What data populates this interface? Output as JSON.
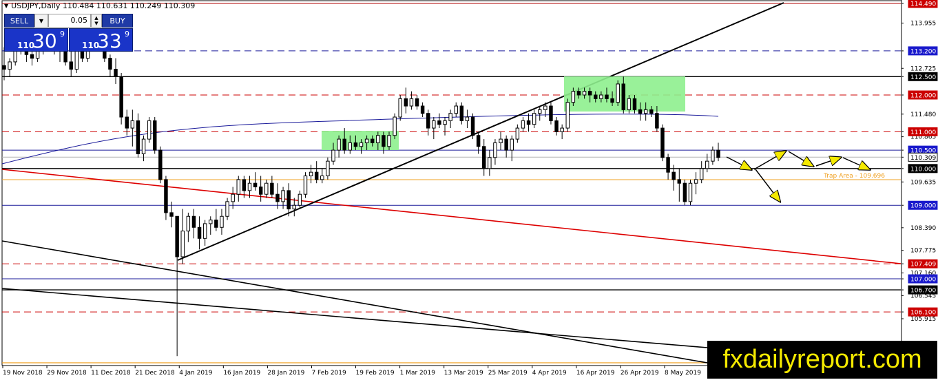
{
  "header": {
    "symbol_line": "USDJPY,Daily  110.484 110.631 110.249 110.309"
  },
  "trade_panel": {
    "sell_label": "SELL",
    "buy_label": "BUY",
    "lot_value": "0.05",
    "sell_price": {
      "prefix": "110",
      "big": "30",
      "sup": "9"
    },
    "buy_price": {
      "prefix": "110",
      "big": "33",
      "sup": "9"
    }
  },
  "watermark": "fxdailyreport.com",
  "chart_data": {
    "type": "candlestick",
    "title": "USDJPY,Daily",
    "ylim": [
      105.35,
      114.6
    ],
    "y_ticks": [
      "114.490",
      "113.955",
      "113.200",
      "112.725",
      "112.500",
      "112.000",
      "111.480",
      "111.000",
      "110.865",
      "110.500",
      "110.309",
      "110.000",
      "109.635",
      "109.000",
      "108.390",
      "107.775",
      "107.409",
      "107.160",
      "107.000",
      "106.700",
      "106.545",
      "106.100",
      "105.915"
    ],
    "x_labels": [
      "19 Nov 2018",
      "29 Nov 2018",
      "11 Dec 2018",
      "21 Dec 2018",
      "4 Jan 2019",
      "16 Jan 2019",
      "28 Jan 2019",
      "7 Feb 2019",
      "19 Feb 2019",
      "1 Mar 2019",
      "13 Mar 2019",
      "25 Mar 2019",
      "4 Apr 2019",
      "16 Apr 2019",
      "26 Apr 2019",
      "8 May 2019"
    ],
    "levels": [
      {
        "price": 114.49,
        "label": "114.490",
        "color": "#b00000",
        "style": "solid",
        "badge": "#cc0000"
      },
      {
        "price": 113.2,
        "label": "113.200",
        "color": "#1a1a9a",
        "style": "dashed",
        "badge": "#1a1acc"
      },
      {
        "price": 112.5,
        "label": "112.500",
        "color": "#000000",
        "style": "solid",
        "badge": "#000000"
      },
      {
        "price": 112.0,
        "label": "112.000",
        "color": "#cc0000",
        "style": "dashed",
        "badge": "#cc0000"
      },
      {
        "price": 111.0,
        "label": "111.000",
        "color": "#cc0000",
        "style": "dashed",
        "badge": "#cc0000"
      },
      {
        "price": 110.5,
        "label": "110.500",
        "color": "#1a1a9a",
        "style": "solid",
        "badge": "#1a1acc"
      },
      {
        "price": 110.309,
        "label": "110.309",
        "color": "#b0b0b0",
        "style": "solid",
        "badge": "#ffffff"
      },
      {
        "price": 110.0,
        "label": "110.000",
        "color": "#000000",
        "style": "solid",
        "badge": "#000000"
      },
      {
        "price": 109.696,
        "label": "",
        "color": "#f0a020",
        "style": "solid",
        "badge": ""
      },
      {
        "price": 109.0,
        "label": "109.000",
        "color": "#1a1a9a",
        "style": "solid",
        "badge": "#1a1acc"
      },
      {
        "price": 107.409,
        "label": "107.409",
        "color": "#cc0000",
        "style": "dashed",
        "badge": "#cc0000"
      },
      {
        "price": 107.0,
        "label": "107.000",
        "color": "#1a1a9a",
        "style": "solid",
        "badge": "#1a1acc"
      },
      {
        "price": 106.7,
        "label": "106.700",
        "color": "#000000",
        "style": "solid",
        "badge": "#000000"
      },
      {
        "price": 106.1,
        "label": "106.100",
        "color": "#cc0000",
        "style": "dashed",
        "badge": "#cc0000"
      }
    ],
    "annotations": [
      {
        "text": "Trap Area - 109.696",
        "color": "#f0a020",
        "price": 109.696
      }
    ],
    "series_ohlc": [
      [
        112.8,
        113.3,
        112.4,
        112.7
      ],
      [
        112.7,
        113.0,
        112.5,
        112.9
      ],
      [
        112.9,
        113.5,
        112.8,
        113.3
      ],
      [
        113.3,
        113.7,
        113.1,
        113.2
      ],
      [
        113.2,
        113.5,
        112.9,
        113.1
      ],
      [
        113.1,
        113.4,
        112.8,
        113.0
      ],
      [
        113.0,
        113.4,
        112.9,
        113.3
      ],
      [
        113.3,
        113.6,
        113.1,
        113.5
      ],
      [
        113.5,
        113.8,
        113.2,
        113.4
      ],
      [
        113.4,
        113.6,
        113.1,
        113.2
      ],
      [
        113.2,
        113.5,
        112.9,
        113.3
      ],
      [
        113.2,
        113.5,
        112.8,
        112.9
      ],
      [
        112.9,
        113.2,
        112.5,
        112.7
      ],
      [
        112.7,
        113.3,
        112.6,
        113.2
      ],
      [
        113.2,
        113.6,
        112.9,
        113.0
      ],
      [
        113.0,
        113.5,
        112.9,
        113.4
      ],
      [
        113.4,
        113.8,
        113.2,
        113.6
      ],
      [
        113.6,
        113.8,
        113.3,
        113.4
      ],
      [
        113.4,
        113.6,
        112.9,
        113.0
      ],
      [
        113.0,
        113.1,
        112.5,
        112.7
      ],
      [
        112.7,
        113.0,
        112.3,
        112.5
      ],
      [
        112.5,
        112.6,
        111.2,
        111.4
      ],
      [
        111.4,
        111.6,
        110.9,
        111.1
      ],
      [
        111.1,
        111.6,
        110.6,
        111.3
      ],
      [
        111.3,
        111.5,
        110.3,
        110.4
      ],
      [
        110.4,
        110.9,
        110.2,
        110.8
      ],
      [
        110.8,
        111.4,
        110.7,
        111.3
      ],
      [
        111.3,
        111.4,
        110.4,
        110.5
      ],
      [
        110.5,
        110.6,
        109.6,
        109.7
      ],
      [
        109.7,
        109.8,
        108.6,
        108.8
      ],
      [
        108.8,
        109.1,
        108.4,
        108.7
      ],
      [
        108.7,
        108.7,
        104.9,
        107.6
      ],
      [
        107.6,
        108.9,
        107.4,
        108.3
      ],
      [
        108.3,
        108.8,
        108.0,
        108.7
      ],
      [
        108.7,
        108.9,
        108.1,
        108.4
      ],
      [
        108.4,
        108.7,
        107.8,
        108.1
      ],
      [
        108.1,
        108.6,
        107.9,
        108.5
      ],
      [
        108.5,
        108.7,
        108.2,
        108.6
      ],
      [
        108.6,
        108.9,
        108.3,
        108.4
      ],
      [
        108.4,
        108.9,
        108.2,
        108.7
      ],
      [
        108.7,
        109.2,
        108.6,
        109.1
      ],
      [
        109.1,
        109.5,
        108.9,
        109.3
      ],
      [
        109.3,
        109.8,
        109.1,
        109.7
      ],
      [
        109.7,
        109.8,
        109.2,
        109.4
      ],
      [
        109.4,
        109.8,
        109.2,
        109.6
      ],
      [
        109.6,
        109.9,
        109.4,
        109.5
      ],
      [
        109.5,
        109.8,
        109.1,
        109.3
      ],
      [
        109.3,
        109.7,
        109.2,
        109.6
      ],
      [
        109.6,
        109.8,
        109.2,
        109.3
      ],
      [
        109.3,
        109.6,
        108.9,
        109.1
      ],
      [
        109.1,
        109.5,
        108.9,
        109.4
      ],
      [
        109.4,
        109.6,
        108.7,
        108.9
      ],
      [
        108.9,
        109.2,
        108.7,
        109.0
      ],
      [
        109.0,
        109.4,
        108.9,
        109.3
      ],
      [
        109.3,
        109.9,
        109.2,
        109.8
      ],
      [
        109.8,
        110.1,
        109.6,
        109.9
      ],
      [
        109.9,
        110.2,
        109.6,
        109.7
      ],
      [
        109.7,
        110.0,
        109.6,
        109.8
      ],
      [
        109.8,
        110.3,
        109.7,
        110.2
      ],
      [
        110.2,
        110.7,
        110.1,
        110.5
      ],
      [
        110.5,
        110.9,
        110.3,
        110.8
      ],
      [
        110.8,
        111.1,
        110.4,
        110.5
      ],
      [
        110.5,
        110.9,
        110.4,
        110.7
      ],
      [
        110.7,
        110.9,
        110.5,
        110.6
      ],
      [
        110.6,
        110.8,
        110.4,
        110.7
      ],
      [
        110.7,
        110.9,
        110.5,
        110.8
      ],
      [
        110.8,
        110.9,
        110.6,
        110.7
      ],
      [
        110.7,
        111.0,
        110.5,
        110.9
      ],
      [
        110.9,
        111.0,
        110.4,
        110.6
      ],
      [
        110.6,
        111.0,
        110.5,
        110.9
      ],
      [
        110.9,
        111.5,
        110.8,
        111.4
      ],
      [
        111.4,
        112.0,
        111.3,
        111.9
      ],
      [
        111.9,
        112.2,
        111.5,
        111.7
      ],
      [
        111.7,
        112.1,
        111.6,
        111.9
      ],
      [
        111.9,
        112.0,
        111.6,
        111.7
      ],
      [
        111.7,
        111.8,
        111.4,
        111.5
      ],
      [
        111.5,
        111.6,
        110.9,
        111.1
      ],
      [
        111.1,
        111.4,
        110.8,
        111.3
      ],
      [
        111.3,
        111.5,
        111.1,
        111.2
      ],
      [
        111.2,
        111.4,
        110.9,
        111.3
      ],
      [
        111.3,
        111.6,
        111.1,
        111.5
      ],
      [
        111.5,
        111.8,
        111.4,
        111.7
      ],
      [
        111.7,
        111.8,
        111.2,
        111.3
      ],
      [
        111.3,
        111.6,
        111.1,
        111.4
      ],
      [
        111.4,
        111.5,
        110.8,
        110.9
      ],
      [
        110.9,
        111.0,
        110.4,
        110.6
      ],
      [
        110.6,
        110.8,
        109.8,
        110.0
      ],
      [
        110.0,
        110.5,
        109.8,
        110.3
      ],
      [
        110.3,
        110.8,
        110.1,
        110.7
      ],
      [
        110.7,
        111.0,
        110.5,
        110.8
      ],
      [
        110.8,
        110.9,
        110.3,
        110.5
      ],
      [
        110.5,
        110.9,
        110.2,
        110.8
      ],
      [
        110.8,
        111.2,
        110.7,
        111.1
      ],
      [
        111.1,
        111.4,
        111.0,
        111.3
      ],
      [
        111.3,
        111.5,
        111.0,
        111.2
      ],
      [
        111.2,
        111.6,
        111.1,
        111.5
      ],
      [
        111.5,
        111.7,
        111.3,
        111.6
      ],
      [
        111.6,
        111.8,
        111.4,
        111.7
      ],
      [
        111.7,
        111.8,
        111.2,
        111.3
      ],
      [
        111.3,
        111.4,
        110.9,
        111.0
      ],
      [
        111.0,
        111.2,
        110.8,
        111.1
      ],
      [
        111.1,
        111.9,
        111.0,
        111.8
      ],
      [
        111.8,
        112.2,
        111.7,
        112.1
      ],
      [
        112.1,
        112.2,
        111.9,
        112.0
      ],
      [
        112.0,
        112.2,
        111.9,
        112.1
      ],
      [
        112.1,
        112.2,
        111.8,
        112.0
      ],
      [
        112.0,
        112.1,
        111.8,
        111.9
      ],
      [
        111.9,
        112.1,
        111.8,
        112.0
      ],
      [
        112.0,
        112.2,
        111.8,
        111.9
      ],
      [
        111.9,
        112.1,
        111.7,
        111.8
      ],
      [
        111.8,
        112.4,
        111.7,
        112.3
      ],
      [
        112.3,
        112.5,
        111.5,
        111.6
      ],
      [
        111.6,
        112.0,
        111.5,
        111.9
      ],
      [
        111.9,
        112.0,
        111.5,
        111.6
      ],
      [
        111.6,
        111.8,
        111.3,
        111.5
      ],
      [
        111.5,
        111.8,
        111.3,
        111.6
      ],
      [
        111.6,
        111.7,
        111.4,
        111.5
      ],
      [
        111.5,
        111.7,
        111.0,
        111.1
      ],
      [
        111.1,
        111.2,
        110.2,
        110.3
      ],
      [
        110.3,
        110.4,
        109.7,
        109.9
      ],
      [
        109.9,
        110.1,
        109.4,
        109.7
      ],
      [
        109.7,
        110.0,
        109.1,
        109.6
      ],
      [
        109.6,
        109.7,
        109.0,
        109.1
      ],
      [
        109.1,
        109.7,
        109.0,
        109.6
      ],
      [
        109.6,
        109.9,
        109.3,
        109.7
      ],
      [
        109.7,
        110.2,
        109.6,
        110.0
      ],
      [
        110.0,
        110.4,
        109.9,
        110.2
      ],
      [
        110.2,
        110.6,
        110.1,
        110.5
      ],
      [
        110.5,
        110.7,
        110.2,
        110.3
      ]
    ]
  }
}
